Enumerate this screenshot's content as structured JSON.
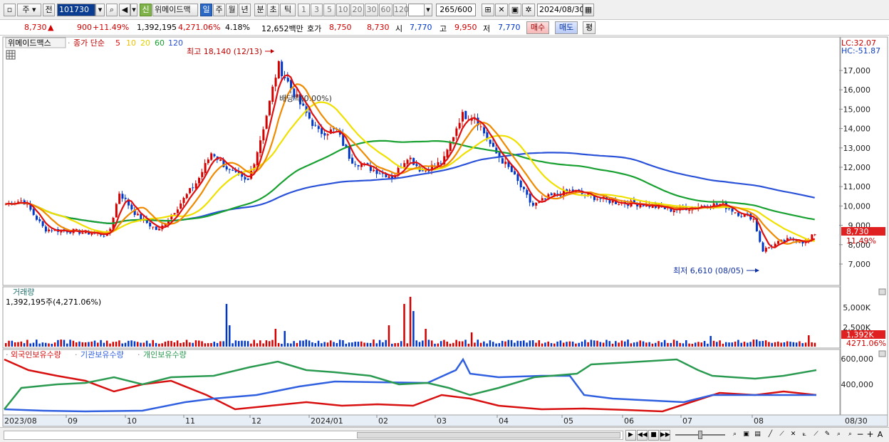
{
  "toolbar": {
    "period_main": "주",
    "period_sub": "전",
    "code": "101730",
    "brand_tag": "신",
    "stock_name": "위메이드맥",
    "period_tabs": [
      "일",
      "주",
      "월",
      "년",
      "분",
      "초",
      "틱"
    ],
    "interval_buttons": [
      "1",
      "3",
      "5",
      "10",
      "20",
      "30",
      "60",
      "120"
    ],
    "count_value": "265",
    "count_total": "/600",
    "date_value": "2024/08/30"
  },
  "quote": {
    "price": "8,730",
    "change": "900",
    "change_pct": "+11.49%",
    "volume": "1,392,195",
    "volume_ratio": "4,271.06%",
    "turnover": "4.18%",
    "amount": "12,652백만",
    "bid_label": "호가",
    "bid1": "8,750",
    "bid2": "8,730",
    "open_label": "시",
    "open": "7,770",
    "high_label": "고",
    "high": "9,950",
    "low_label": "저",
    "low": "7,770",
    "buy_btn": "매수",
    "sell_btn": "매도",
    "eval_btn": "평"
  },
  "price_panel": {
    "stock_tab": "위메이드맥스",
    "legend_prefix": "종가 단순",
    "ma_labels": [
      "5",
      "10",
      "20",
      "60",
      "120"
    ],
    "ma_colors": [
      "#e01010",
      "#f08a00",
      "#f0e000",
      "#18a030",
      "#2a52d8"
    ],
    "lc": "LC:32.07",
    "hc": "HC:-51.87",
    "max_annot": "최고 18,140 (12/13)",
    "min_annot": "최저 6,610 (08/05)",
    "ex_annot": "배당락(0.00%)",
    "current_tag": "8,730",
    "current_pct": "11.49%",
    "y_ticks": [
      "17,000",
      "16,000",
      "15,000",
      "14,000",
      "13,000",
      "12,000",
      "11,000",
      "10,000",
      "9,000",
      "8,000",
      "7,000"
    ]
  },
  "volume_panel": {
    "title": "거래량",
    "value": "1,392,195주(4,271.06%)",
    "y_ticks": [
      "5,000K",
      "2,500K"
    ],
    "current_tag": "1,392K",
    "current_pct": "4271.06%"
  },
  "holdings_panel": {
    "legend": [
      "외국인보유수량",
      "기관보유수량",
      "개인보유수량"
    ],
    "legend_colors": [
      "#d81010",
      "#3060e0",
      "#2a9a50"
    ],
    "y_ticks": [
      "600,000",
      "400,000"
    ]
  },
  "x_axis": {
    "labels": [
      "2023/08",
      "09",
      "10",
      "11",
      "12",
      "2024/01",
      "02",
      "03",
      "04",
      "05",
      "06",
      "07",
      "08",
      "08/30"
    ]
  },
  "colors": {
    "up": "#d40000",
    "down": "#0037c8"
  }
}
